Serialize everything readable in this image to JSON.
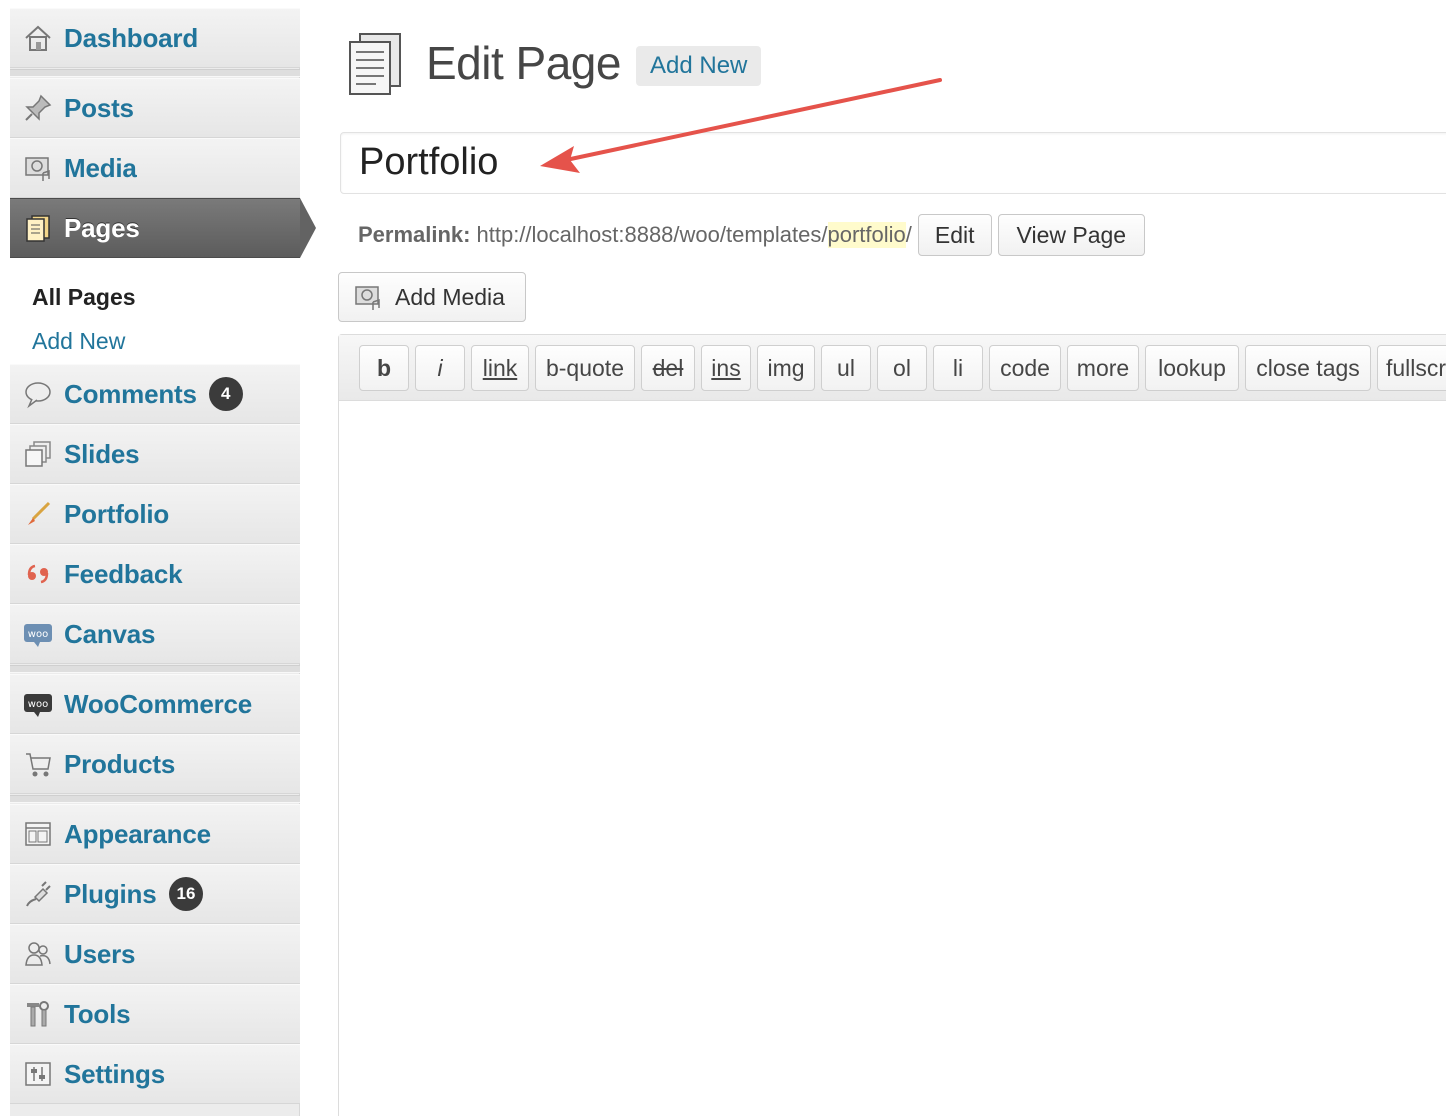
{
  "sidebar": {
    "items": [
      {
        "key": "dashboard",
        "label": "Dashboard",
        "icon": "house-icon"
      },
      {
        "key": "posts",
        "label": "Posts",
        "icon": "pushpin-icon"
      },
      {
        "key": "media",
        "label": "Media",
        "icon": "media-camera-icon"
      },
      {
        "key": "pages",
        "label": "Pages",
        "icon": "pages-icon",
        "current": true
      },
      {
        "key": "comments",
        "label": "Comments",
        "icon": "speech-bubble-icon",
        "count": "4"
      },
      {
        "key": "slides",
        "label": "Slides",
        "icon": "slides-stack-icon"
      },
      {
        "key": "portfolio",
        "label": "Portfolio",
        "icon": "paintbrush-icon"
      },
      {
        "key": "feedback",
        "label": "Feedback",
        "icon": "quote-marks-icon"
      },
      {
        "key": "canvas",
        "label": "Canvas",
        "icon": "woo-canvas-icon"
      },
      {
        "key": "woocommerce",
        "label": "WooCommerce",
        "icon": "woo-bubble-icon"
      },
      {
        "key": "products",
        "label": "Products",
        "icon": "shopping-cart-icon"
      },
      {
        "key": "appearance",
        "label": "Appearance",
        "icon": "appearance-layout-icon"
      },
      {
        "key": "plugins",
        "label": "Plugins",
        "icon": "plug-icon",
        "count": "16"
      },
      {
        "key": "users",
        "label": "Users",
        "icon": "users-icon"
      },
      {
        "key": "tools",
        "label": "Tools",
        "icon": "tools-icon"
      },
      {
        "key": "settings",
        "label": "Settings",
        "icon": "settings-sliders-icon"
      }
    ],
    "submenu": {
      "all_pages": "All Pages",
      "add_new": "Add New"
    }
  },
  "header": {
    "title": "Edit Page",
    "add_new": "Add New"
  },
  "post": {
    "title": "Portfolio"
  },
  "permalink": {
    "label": "Permalink:",
    "url_base": "http://localhost:8888/woo/templates/",
    "slug": "portfolio",
    "trailing": "/",
    "edit_label": "Edit",
    "view_label": "View Page"
  },
  "media": {
    "add_media_label": "Add Media"
  },
  "quicktags": [
    "b",
    "i",
    "link",
    "b-quote",
    "del",
    "ins",
    "img",
    "ul",
    "ol",
    "li",
    "code",
    "more",
    "lookup",
    "close tags",
    "fullscr"
  ],
  "colors": {
    "link": "#21759b",
    "current_menu": "#636363",
    "annotation_arrow": "#e5534b",
    "slug_highlight": "#fffbcc"
  }
}
